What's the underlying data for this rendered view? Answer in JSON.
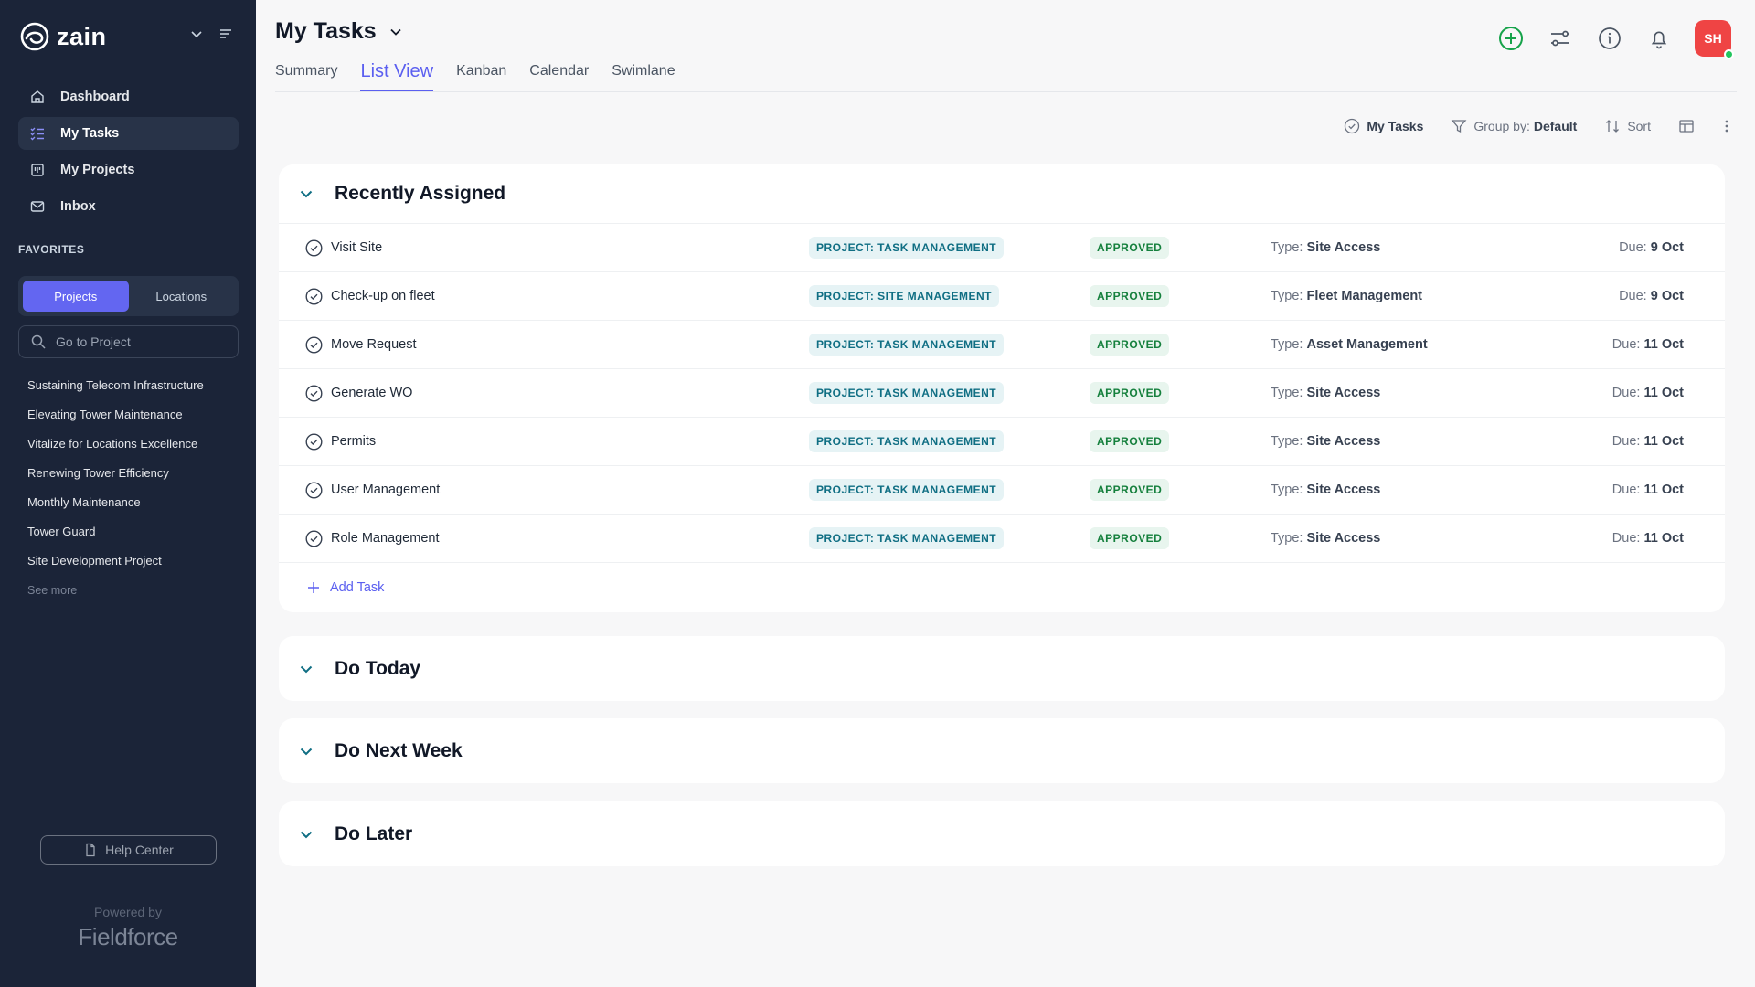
{
  "brand": {
    "name": "zain"
  },
  "nav": [
    {
      "label": "Dashboard",
      "icon": "home-icon"
    },
    {
      "label": "My Tasks",
      "icon": "tasks-icon",
      "active": true
    },
    {
      "label": "My Projects",
      "icon": "projects-icon"
    },
    {
      "label": "Inbox",
      "icon": "inbox-icon"
    }
  ],
  "favorites": {
    "title": "FAVORITES",
    "tabs": [
      "Projects",
      "Locations"
    ],
    "search_placeholder": "Go to Project",
    "projects": [
      "Sustaining Telecom Infrastructure",
      "Elevating Tower Maintenance",
      "Vitalize for Locations Excellence",
      "Renewing Tower Efficiency",
      "Monthly Maintenance",
      "Tower Guard",
      "Site Development Project"
    ],
    "see_more": "See more"
  },
  "help_center": "Help Center",
  "powered_by": "Powered by",
  "powered_brand": "Fieldforce",
  "header": {
    "title": "My Tasks",
    "tabs": [
      "Summary",
      "List View",
      "Kanban",
      "Calendar",
      "Swimlane"
    ],
    "active_tab": "List View",
    "avatar_initials": "SH"
  },
  "toolbar": {
    "filter_label": "My Tasks",
    "group_prefix": "Group by:",
    "group_value": "Default",
    "sort_label": "Sort"
  },
  "sections": [
    {
      "title": "Recently Assigned",
      "expanded": true,
      "tasks": [
        {
          "name": "Visit Site",
          "project": "PROJECT: TASK MANAGEMENT",
          "status": "APPROVED",
          "type_label": "Type:",
          "type": "Site Access",
          "due_label": "Due:",
          "due": "9 Oct"
        },
        {
          "name": "Check-up on fleet",
          "project": "PROJECT: SITE MANAGEMENT",
          "status": "APPROVED",
          "type_label": "Type:",
          "type": "Fleet Management",
          "due_label": "Due:",
          "due": "9 Oct"
        },
        {
          "name": "Move Request",
          "project": "PROJECT: TASK MANAGEMENT",
          "status": "APPROVED",
          "type_label": "Type:",
          "type": "Asset Management",
          "due_label": "Due:",
          "due": "11 Oct"
        },
        {
          "name": "Generate WO",
          "project": "PROJECT: TASK MANAGEMENT",
          "status": "APPROVED",
          "type_label": "Type:",
          "type": "Site Access",
          "due_label": "Due:",
          "due": "11 Oct"
        },
        {
          "name": "Permits",
          "project": "PROJECT: TASK MANAGEMENT",
          "status": "APPROVED",
          "type_label": "Type:",
          "type": "Site Access",
          "due_label": "Due:",
          "due": "11 Oct"
        },
        {
          "name": "User Management",
          "project": "PROJECT: TASK MANAGEMENT",
          "status": "APPROVED",
          "type_label": "Type:",
          "type": "Site Access",
          "due_label": "Due:",
          "due": "11 Oct"
        },
        {
          "name": "Role Management",
          "project": "PROJECT: TASK MANAGEMENT",
          "status": "APPROVED",
          "type_label": "Type:",
          "type": "Site Access",
          "due_label": "Due:",
          "due": "11 Oct"
        }
      ],
      "add_task_label": "Add Task"
    },
    {
      "title": "Do Today"
    },
    {
      "title": "Do Next Week"
    },
    {
      "title": "Do Later"
    }
  ],
  "colors": {
    "sidebar_bg": "#1b2438",
    "accent": "#5b5ff0",
    "add_icon": "#16a34a",
    "avatar": "#ef4444",
    "status_text": "#15803d",
    "project_text": "#0f6e83"
  }
}
